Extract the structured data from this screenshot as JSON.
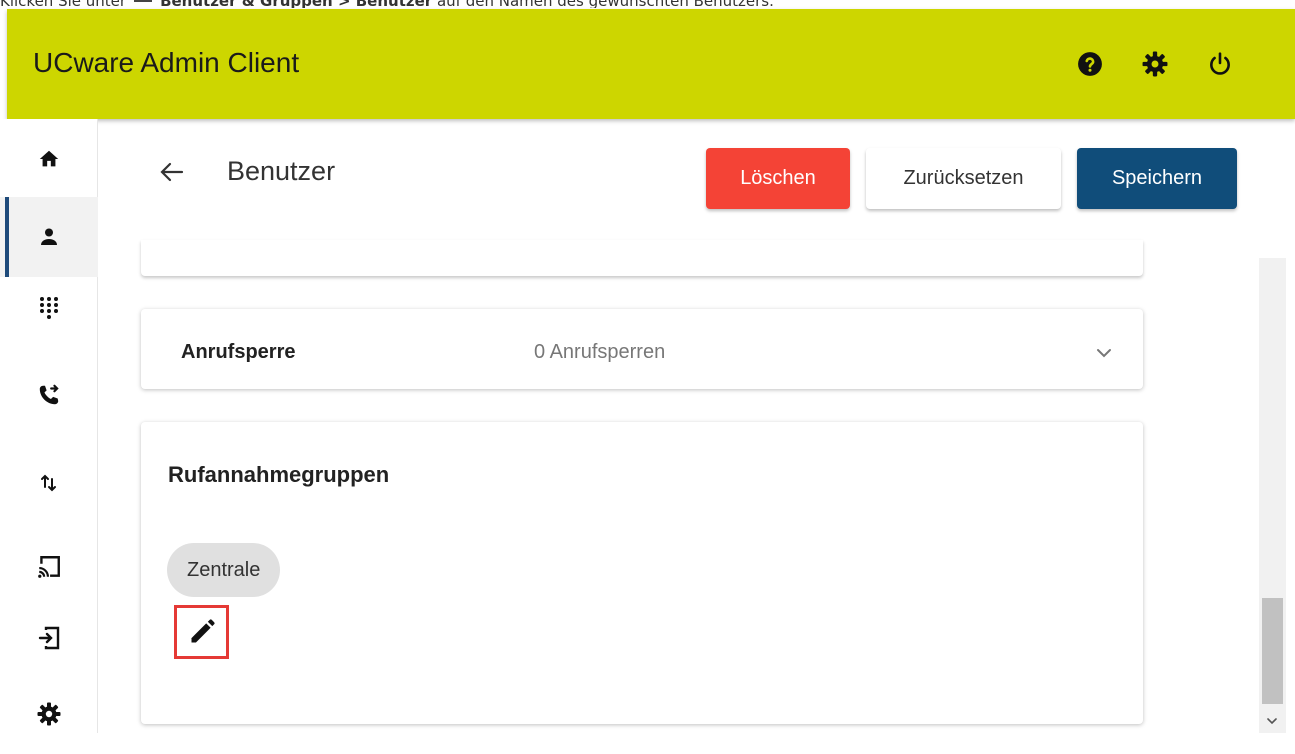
{
  "caption": {
    "prefix": "Klicken Sie unter",
    "icon": "users-icon",
    "path_bold": "Benutzer & Gruppen > Benutzer",
    "suffix": "auf den Namen des gewünschten Benutzers."
  },
  "appbar": {
    "title": "UCware Admin Client",
    "icons": [
      "help-icon",
      "gear-icon",
      "power-icon"
    ],
    "color": "#cdd600"
  },
  "sidebar": {
    "items": [
      {
        "icon": "home-icon",
        "active": false
      },
      {
        "icon": "user-icon",
        "active": true
      },
      {
        "icon": "dialpad-icon",
        "active": false
      },
      {
        "icon": "phone-forward-icon",
        "active": false
      },
      {
        "icon": "swap-vert-icon",
        "active": false
      },
      {
        "icon": "cast-icon",
        "active": false
      },
      {
        "icon": "login-icon",
        "active": false
      },
      {
        "icon": "gear-icon",
        "active": false
      }
    ],
    "active_color": "#1e4a7a"
  },
  "header": {
    "back_icon": "arrow-left-icon",
    "title": "Benutzer",
    "delete_label": "Löschen",
    "reset_label": "Zurücksetzen",
    "save_label": "Speichern",
    "delete_color": "#f44336",
    "save_color": "#104d7a"
  },
  "call_block": {
    "label": "Anrufsperre",
    "value": "0 Anrufsperren",
    "chevron_icon": "chevron-down-icon"
  },
  "pickup_groups": {
    "title": "Rufannahmegruppen",
    "chips": [
      "Zentrale"
    ],
    "edit_icon": "pencil-icon",
    "highlight_color": "#e53935"
  }
}
